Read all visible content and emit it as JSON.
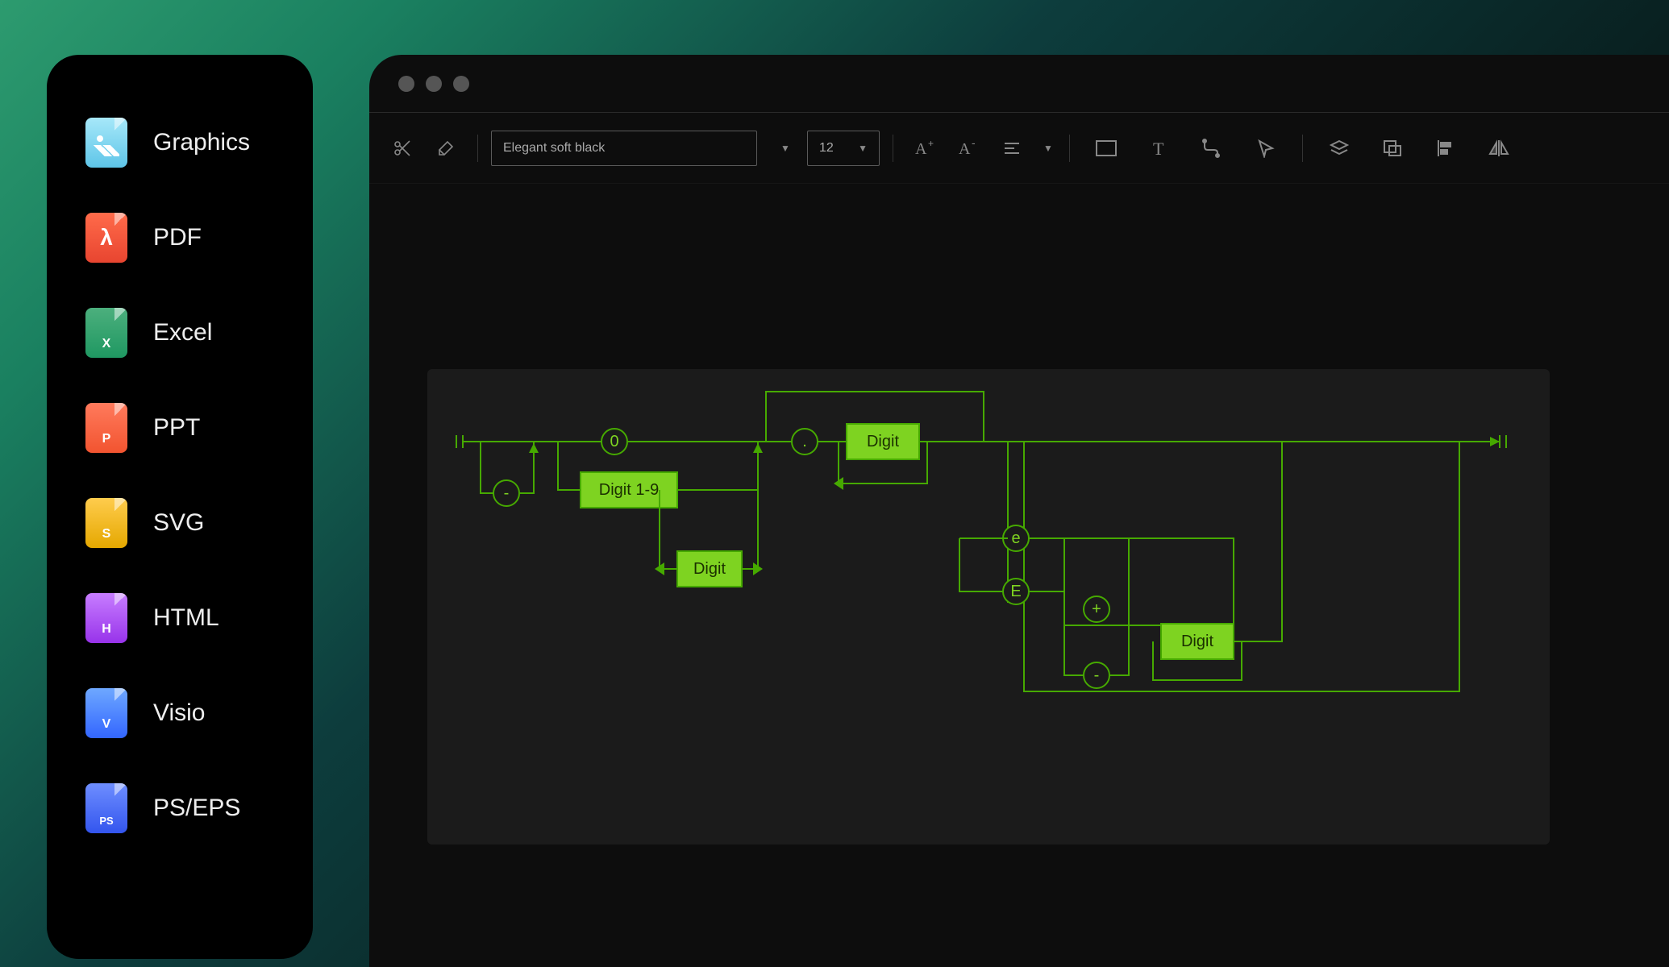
{
  "sidebar": {
    "items": [
      {
        "label": "Graphics",
        "icon": "graphics"
      },
      {
        "label": "PDF",
        "icon": "pdf"
      },
      {
        "label": "Excel",
        "icon": "excel",
        "badge": "X"
      },
      {
        "label": "PPT",
        "icon": "ppt",
        "badge": "P"
      },
      {
        "label": "SVG",
        "icon": "svg",
        "badge": "S"
      },
      {
        "label": "HTML",
        "icon": "html",
        "badge": "H"
      },
      {
        "label": "Visio",
        "icon": "visio",
        "badge": "V"
      },
      {
        "label": "PS/EPS",
        "icon": "ps",
        "badge": "PS"
      }
    ]
  },
  "toolbar": {
    "style_name": "Elegant soft black",
    "font_size": "12"
  },
  "diagram": {
    "nodes": {
      "zero": "0",
      "minus": "-",
      "digit19": "Digit 1-9",
      "digit_loop": "Digit",
      "dot": ".",
      "digit_frac": "Digit",
      "exp_e": "e",
      "exp_E": "E",
      "plus": "+",
      "minus2": "-",
      "digit_exp": "Digit"
    }
  }
}
